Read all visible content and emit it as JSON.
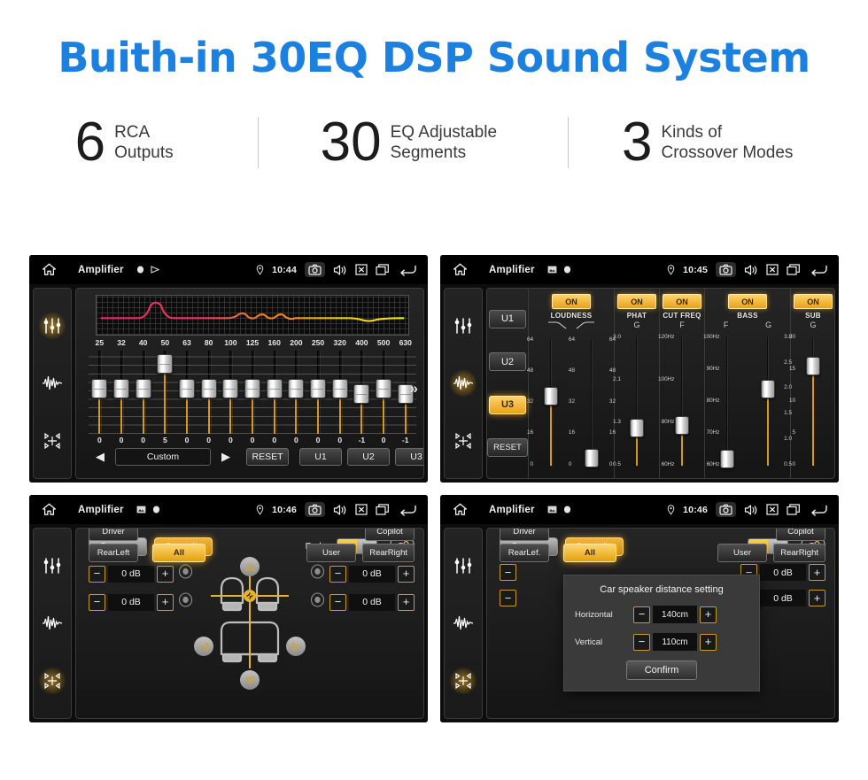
{
  "headline": "Buith-in 30EQ DSP Sound System",
  "stats": [
    {
      "number": "6",
      "text": "RCA\nOutputs"
    },
    {
      "number": "30",
      "text": "EQ Adjustable\nSegments"
    },
    {
      "number": "3",
      "text": "Kinds of\nCrossover Modes"
    }
  ],
  "colors": {
    "headline_blue": "#1b80e0",
    "accent_amber": "#e8a11a",
    "panel_black": "#0a0a0a"
  },
  "panels": {
    "eq": {
      "statusbar": {
        "title": "Amplifier",
        "time": "10:44",
        "icons": [
          "home-icon",
          "gallery-icon",
          "record-dot-icon",
          "play-icon",
          "location-pin-icon",
          "camera-icon",
          "volume-icon",
          "close-box-icon",
          "recents-icon",
          "back-icon"
        ]
      },
      "sidebar_icons": [
        "eq-sliders-icon",
        "waveform-icon",
        "balance-icon"
      ],
      "active_sidebar": "eq-sliders-icon",
      "frequencies": [
        "25",
        "32",
        "40",
        "50",
        "63",
        "80",
        "100",
        "125",
        "160",
        "200",
        "250",
        "320",
        "400",
        "500",
        "630"
      ],
      "values": [
        "0",
        "0",
        "0",
        "5",
        "0",
        "0",
        "0",
        "0",
        "0",
        "0",
        "0",
        "0",
        "-1",
        "0",
        "-1"
      ],
      "next_chevron": "»",
      "prev_label": "◀",
      "next_label": "▶",
      "preset": "Custom",
      "reset_label": "RESET",
      "user_presets": [
        "U1",
        "U2",
        "U3"
      ]
    },
    "dsp": {
      "statusbar": {
        "title": "Amplifier",
        "time": "10:45"
      },
      "sidebar_icons": [
        "eq-sliders-icon",
        "waveform-icon",
        "balance-icon"
      ],
      "active_sidebar": "waveform-icon",
      "user_buttons": [
        {
          "label": "U1",
          "active": false
        },
        {
          "label": "U2",
          "active": false
        },
        {
          "label": "U3",
          "active": true
        }
      ],
      "reset_label": "RESET",
      "columns": [
        {
          "name": "LOUDNESS",
          "state": "ON",
          "axes": [
            "curve-left-icon",
            "curve-right-icon"
          ],
          "sliders": [
            {
              "scale_left": [
                "64",
                "48",
                "32",
                "16",
                "0"
              ],
              "scale_right": [
                "64",
                "48",
                "32",
                "16",
                "0"
              ],
              "position_pct": 52
            },
            {
              "scale_left": [],
              "scale_right": [
                "64",
                "48",
                "32",
                "16",
                "0"
              ],
              "position_pct": 10
            }
          ]
        },
        {
          "name": "PHAT",
          "state": "ON",
          "axes": [
            "G"
          ],
          "sliders": [
            {
              "scale_left": [
                "3.0",
                "2.1",
                "1.3",
                "0.5"
              ],
              "scale_right": [],
              "position_pct": 28
            }
          ]
        },
        {
          "name": "CUT FREQ",
          "state": "ON",
          "axes": [
            "F"
          ],
          "sliders": [
            {
              "scale_left": [
                "120Hz",
                "100Hz",
                "80Hz",
                "60Hz"
              ],
              "scale_right": [],
              "position_pct": 30
            }
          ]
        },
        {
          "name": "BASS",
          "state": "ON",
          "axes": [
            "F",
            "G"
          ],
          "sliders": [
            {
              "scale_left": [
                "100Hz",
                "90Hz",
                "80Hz",
                "70Hz",
                "60Hz"
              ],
              "scale_right": [],
              "position_pct": 6
            },
            {
              "scale_left": [],
              "scale_right": [
                "3.0",
                "2.5",
                "2.0",
                "1.5",
                "1.0",
                "0.5"
              ],
              "position_pct": 55
            }
          ]
        },
        {
          "name": "SUB",
          "state": "ON",
          "axes": [
            "G"
          ],
          "sliders": [
            {
              "scale_left": [
                "20",
                "15",
                "10",
                "5",
                "0"
              ],
              "scale_right": [],
              "position_pct": 72
            }
          ]
        }
      ]
    },
    "fader": {
      "statusbar": {
        "title": "Amplifier",
        "time": "10:46"
      },
      "sidebar_icons": [
        "eq-sliders-icon",
        "waveform-icon",
        "balance-icon"
      ],
      "active_sidebar": "balance-icon",
      "tabs": [
        {
          "label": "Common",
          "active": false
        },
        {
          "label": "Specialty",
          "active": true
        }
      ],
      "fader_label": "Fader",
      "fader_toggle": "ON",
      "seat_button": "car-seat-settings-icon",
      "gain_controls": [
        {
          "position": "front-left",
          "minus": "−",
          "value": "0 dB",
          "plus": "+",
          "speaker": "speaker-icon"
        },
        {
          "position": "rear-left",
          "minus": "−",
          "value": "0 dB",
          "plus": "+",
          "speaker": "speaker-icon"
        },
        {
          "position": "front-right",
          "minus": "−",
          "value": "0 dB",
          "plus": "+",
          "speaker": "speaker-icon"
        },
        {
          "position": "rear-right",
          "minus": "−",
          "value": "0 dB",
          "plus": "+",
          "speaker": "speaker-icon"
        }
      ],
      "seat_buttons": [
        {
          "label": "Driver",
          "active": false
        },
        {
          "label": "Copilot",
          "active": false
        },
        {
          "label": "RearLeft",
          "active": false
        },
        {
          "label": "All",
          "active": true
        },
        {
          "label": "User",
          "active": false
        },
        {
          "label": "RearRight",
          "active": false
        }
      ]
    },
    "dialog_panel": {
      "statusbar": {
        "title": "Amplifier",
        "time": "10:46"
      },
      "sidebar_icons": [
        "eq-sliders-icon",
        "waveform-icon",
        "balance-icon"
      ],
      "active_sidebar": "balance-icon",
      "tabs": [
        {
          "label": "Common",
          "active": false
        },
        {
          "label": "Specialty",
          "active": true
        }
      ],
      "fader_toggle": "ON",
      "seat_button": "car-seat-settings-icon",
      "gain_controls": [
        {
          "position": "front-right",
          "minus": "−",
          "value": "0 dB",
          "plus": "+"
        },
        {
          "position": "rear-right",
          "minus": "−",
          "value": "0 dB",
          "plus": "+"
        }
      ],
      "seat_buttons": [
        {
          "label": "Driver",
          "active": false
        },
        {
          "label": "Copilot",
          "active": false
        },
        {
          "label": "RearLef.",
          "active": false
        },
        {
          "label": "All",
          "active": true
        },
        {
          "label": "User",
          "active": false
        },
        {
          "label": "RearRight",
          "active": false
        }
      ],
      "dialog": {
        "title": "Car speaker distance setting",
        "rows": [
          {
            "label": "Horizontal",
            "minus": "−",
            "value": "140cm",
            "plus": "+"
          },
          {
            "label": "Vertical",
            "minus": "−",
            "value": "110cm",
            "plus": "+"
          }
        ],
        "confirm_label": "Confirm"
      }
    }
  }
}
